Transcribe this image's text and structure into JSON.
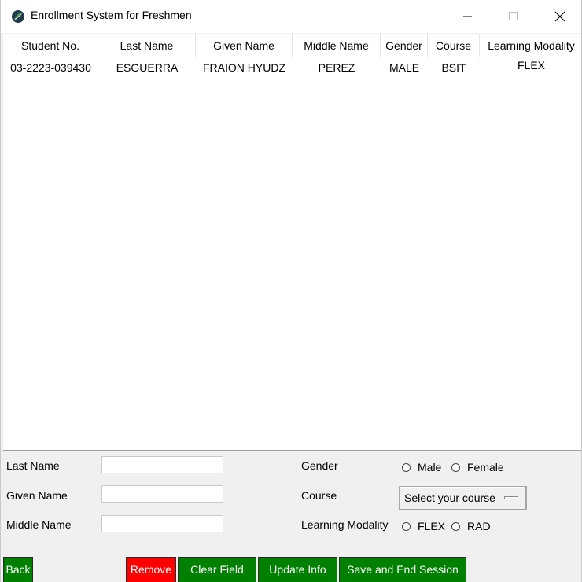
{
  "window": {
    "title": "Enrollment System for Freshmen",
    "icons": {
      "app": "feather-app-icon",
      "minimize": "minimize-icon",
      "maximize": "maximize-icon",
      "close": "close-icon"
    }
  },
  "table": {
    "columns": [
      "Student No.",
      "Last Name",
      "Given Name",
      "Middle Name",
      "Gender",
      "Course",
      "Learning Modality"
    ],
    "rows": [
      [
        "03-2223-039430",
        "ESGUERRA",
        "FRAION HYUDZ",
        "PEREZ",
        "MALE",
        "BSIT",
        "FLEX"
      ]
    ]
  },
  "form": {
    "last_name_label": "Last Name",
    "given_name_label": "Given Name",
    "middle_name_label": "Middle Name",
    "last_name_value": "",
    "given_name_value": "",
    "middle_name_value": "",
    "gender_label": "Gender",
    "gender_options": [
      "Male",
      "Female"
    ],
    "course_label": "Course",
    "course_placeholder": "Select your course",
    "modality_label": "Learning Modality",
    "modality_options": [
      "FLEX",
      "RAD"
    ]
  },
  "buttons": {
    "back": "Back",
    "remove": "Remove",
    "clear": "Clear Field",
    "update": "Update Info",
    "save": "Save and End Session"
  },
  "colors": {
    "button_green": "#008000",
    "button_red": "#ff0000"
  }
}
